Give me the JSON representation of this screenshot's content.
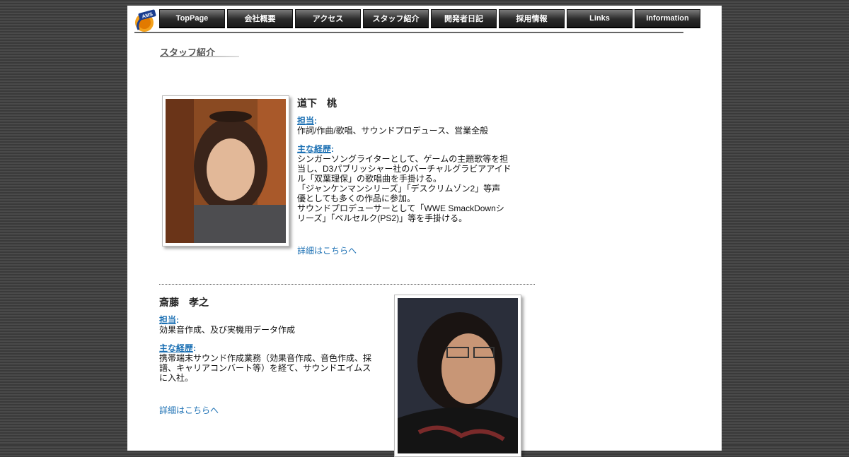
{
  "nav": {
    "items": [
      {
        "label": "TopPage"
      },
      {
        "label": "会社概要"
      },
      {
        "label": "アクセス"
      },
      {
        "label": "スタッフ紹介"
      },
      {
        "label": "開発者日記"
      },
      {
        "label": "採用情報"
      },
      {
        "label": "Links"
      },
      {
        "label": "Information"
      }
    ]
  },
  "logo": {
    "text": "AMS"
  },
  "page_title": "スタッフ紹介",
  "staff": [
    {
      "name": "道下　桃",
      "role_label": "担当",
      "role": "作詞/作曲/歌唱、サウンドプロデュース、営業全般",
      "career_label": "主な経歴",
      "career_lines": [
        "シンガーソングライターとして、ゲームの主題歌等を担",
        "当し、D3パブリッシャー社のバーチャルグラビアアイド",
        "ル「双葉理保」の歌唱曲を手掛ける。",
        "「ジャンケンマンシリーズ」「デスクリムゾン2」等声",
        "優としても多くの作品に参加。",
        "サウンドプロデューサーとして「WWE SmackDownシ",
        "リーズ」「ベルセルク(PS2)」等を手掛ける。"
      ],
      "details_link": "詳細はこちらへ"
    },
    {
      "name": "斎藤　孝之",
      "role_label": "担当",
      "role": "効果音作成、及び実機用データ作成",
      "career_label": "主な経歴",
      "career_lines": [
        "携帯端末サウンド作成業務（効果音作成、音色作成、採",
        "譜、キャリアコンバート等）を経て、サウンドエイムス",
        "に入社。"
      ],
      "details_link": "詳細はこちらへ"
    }
  ],
  "colors": {
    "accent": "#1a6fb3",
    "nav_bg": "#2a2a2a"
  }
}
